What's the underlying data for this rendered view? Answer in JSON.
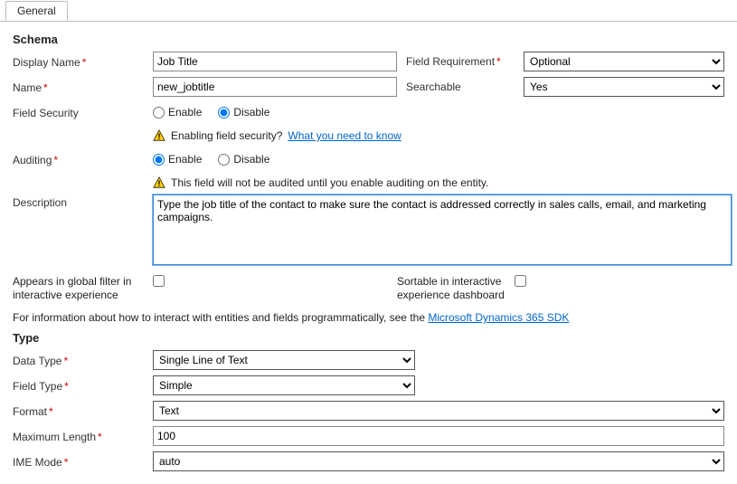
{
  "tab": {
    "general": "General"
  },
  "schema": {
    "heading": "Schema",
    "displayName": {
      "label": "Display Name",
      "value": "Job Title"
    },
    "fieldRequirement": {
      "label": "Field Requirement",
      "value": "Optional"
    },
    "name": {
      "label": "Name",
      "value": "new_jobtitle"
    },
    "searchable": {
      "label": "Searchable",
      "value": "Yes"
    },
    "fieldSecurity": {
      "label": "Field Security",
      "enable": "Enable",
      "disable": "Disable"
    },
    "securityWarn": {
      "text": "Enabling field security?",
      "link": "What you need to know"
    },
    "auditing": {
      "label": "Auditing",
      "enable": "Enable",
      "disable": "Disable"
    },
    "auditWarn": "This field will not be audited until you enable auditing on the entity.",
    "description": {
      "label": "Description",
      "value": "Type the job title of the contact to make sure the contact is addressed correctly in sales calls, email, and marketing campaigns."
    },
    "globalFilter": "Appears in global filter in interactive experience",
    "sortable": "Sortable in interactive experience dashboard",
    "sdkInfo": {
      "prefix": "For information about how to interact with entities and fields programmatically, see the ",
      "link": "Microsoft Dynamics 365 SDK"
    }
  },
  "type": {
    "heading": "Type",
    "dataType": {
      "label": "Data Type",
      "value": "Single Line of Text"
    },
    "fieldType": {
      "label": "Field Type",
      "value": "Simple"
    },
    "format": {
      "label": "Format",
      "value": "Text"
    },
    "maxLength": {
      "label": "Maximum Length",
      "value": "100"
    },
    "imeMode": {
      "label": "IME Mode",
      "value": "auto"
    }
  }
}
